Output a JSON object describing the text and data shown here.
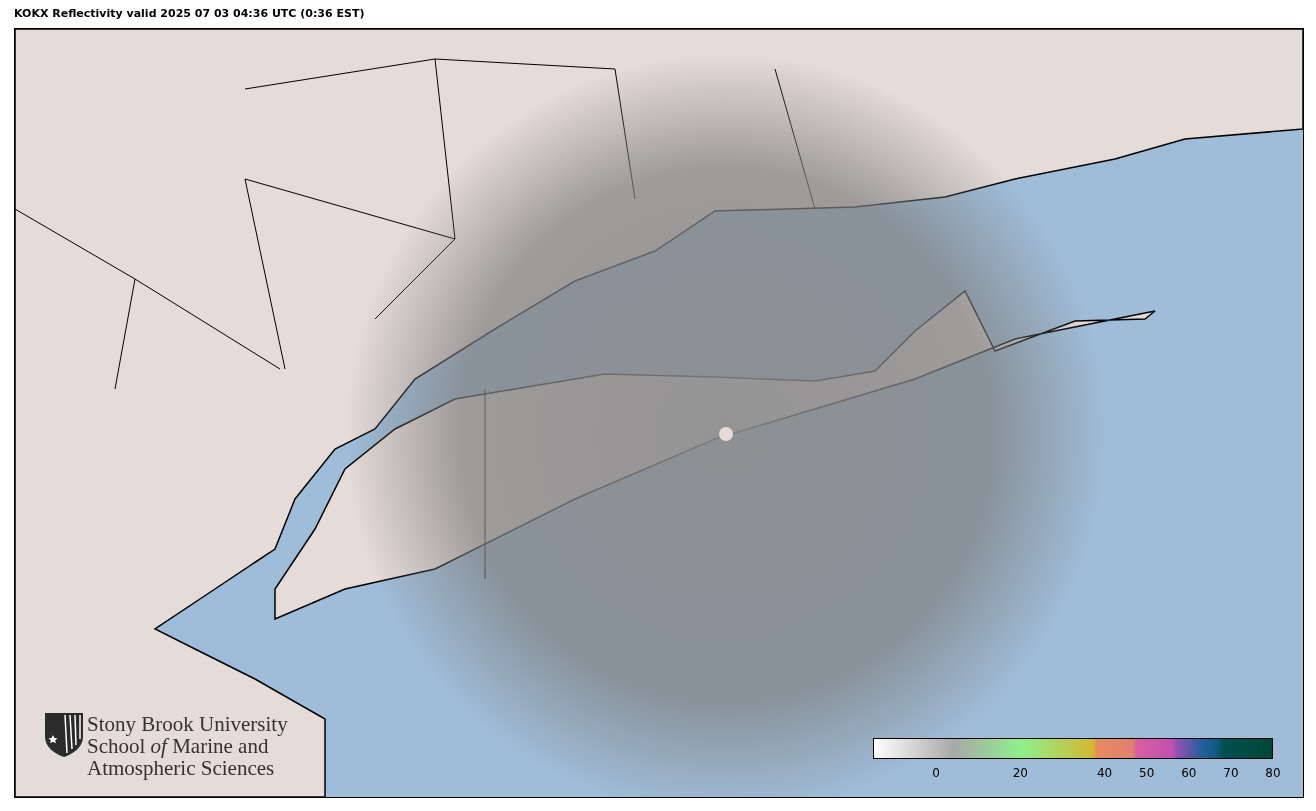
{
  "title": "KOKX Reflectivity valid 2025 07 03 04:36 UTC (0:36 EST)",
  "logo": {
    "lines": [
      "Stony Brook University",
      "School *of* Marine and",
      "Atmospheric Sciences"
    ]
  },
  "colorbar": {
    "ticks": [
      "0",
      "20",
      "40",
      "50",
      "60",
      "70",
      "80"
    ]
  }
}
